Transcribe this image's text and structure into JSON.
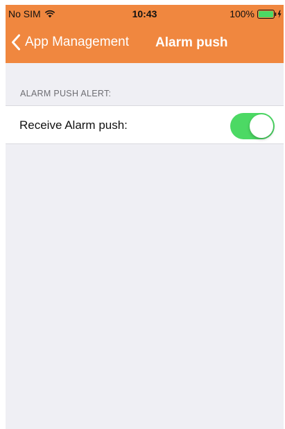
{
  "status_bar": {
    "carrier": "No SIM",
    "time": "10:43",
    "battery": "100%",
    "icons": [
      "wifi-icon",
      "battery-icon",
      "charging-bolt-icon"
    ]
  },
  "navbar": {
    "back_label": "App Management",
    "title": "Alarm push",
    "background_color": "#f0873f"
  },
  "section": {
    "header": "ALARM PUSH ALERT:",
    "rows": [
      {
        "label": "Receive Alarm push:",
        "toggle_on": true,
        "toggle_color": "#4cd964"
      }
    ]
  }
}
